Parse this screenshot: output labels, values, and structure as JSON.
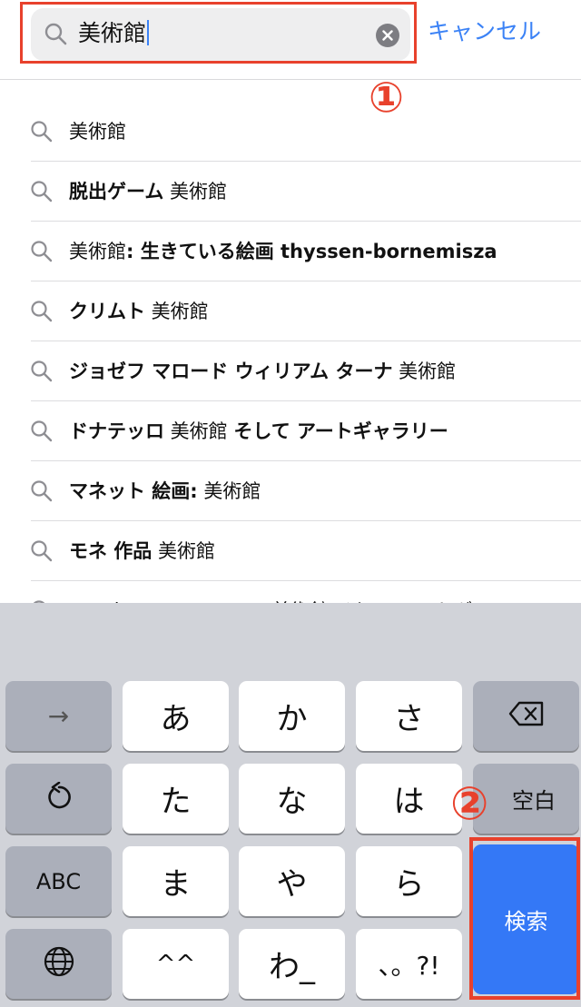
{
  "search": {
    "query": "美術館",
    "cancel_label": "キャンセル",
    "annotation_1": "①"
  },
  "suggestions": [
    [
      {
        "t": "美術館",
        "b": false
      }
    ],
    [
      {
        "t": "脱出ゲーム",
        "b": true
      },
      {
        "t": " 美術館",
        "b": false
      }
    ],
    [
      {
        "t": "美術館",
        "b": false
      },
      {
        "t": ": 生きている絵画 thyssen-bornemisza",
        "b": true
      }
    ],
    [
      {
        "t": "クリムト",
        "b": true
      },
      {
        "t": " 美術館",
        "b": false
      }
    ],
    [
      {
        "t": "ジョゼフ マロード ウィリアム ターナ",
        "b": true
      },
      {
        "t": " 美術館",
        "b": false
      }
    ],
    [
      {
        "t": "ドナテッロ",
        "b": true
      },
      {
        "t": " 美術館 ",
        "b": false
      },
      {
        "t": "そして アートギャラリー",
        "b": true
      }
    ],
    [
      {
        "t": "マネット 絵画:",
        "b": true
      },
      {
        "t": " 美術館",
        "b": false
      }
    ],
    [
      {
        "t": "モネ 作品",
        "b": true
      },
      {
        "t": " 美術館",
        "b": false
      }
    ],
    [
      {
        "t": "ヨハネス フェルメール 美術館 そして アートギャラリー",
        "b": false
      }
    ]
  ],
  "keyboard": {
    "arrow_key": "→",
    "keys": [
      "あ",
      "か",
      "さ",
      "た",
      "な",
      "は",
      "ま",
      "や",
      "ら",
      "^^",
      "わ_",
      "、。?!"
    ],
    "undo_key": "↺",
    "abc_key": "ABC",
    "backspace_key": "⌫",
    "space_key": "空白",
    "search_key": "検索",
    "annotation_2": "②"
  },
  "colors": {
    "accent": "#3478f6",
    "annotation": "#e8412c"
  }
}
